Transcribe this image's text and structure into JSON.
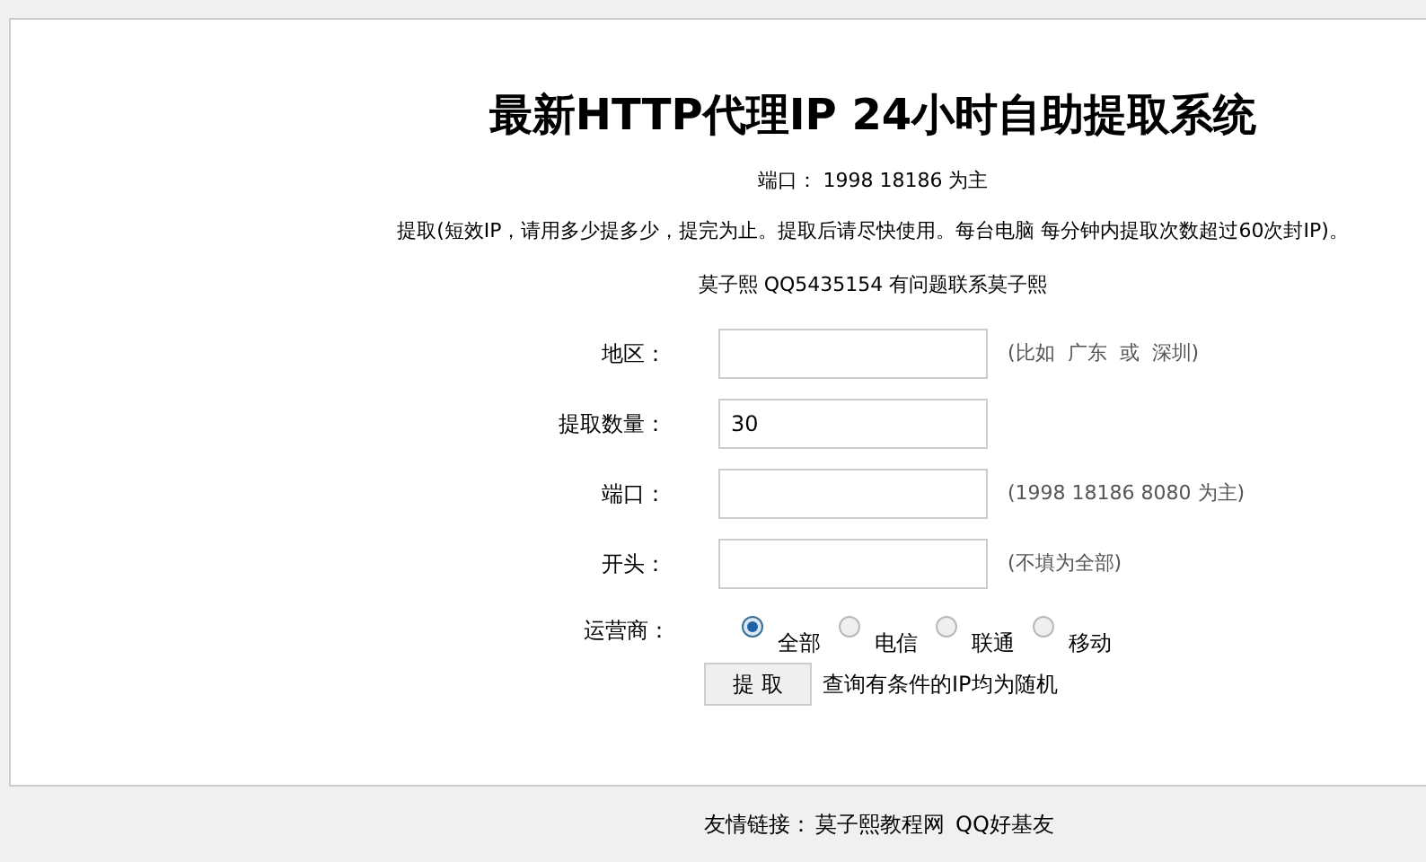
{
  "title": "最新HTTP代理IP 24小时自助提取系统",
  "port_note": "端口： 1998 18186 为主",
  "usage_note": "提取(短效IP，请用多少提多少，提完为止。提取后请尽快使用。每台电脑 每分钟内提取次数超过60次封IP)。",
  "contact_note": "莫子熙 QQ5435154 有问题联系莫子熙",
  "fields": [
    {
      "label": "地区：",
      "hint": "(比如  广东  或  深圳)"
    },
    {
      "label": "提取数量：",
      "value": "30"
    },
    {
      "label": "端口：",
      "hint": "(1998 18186 8080 为主)"
    },
    {
      "label": "开头：",
      "hint": "(不填为全部)"
    }
  ],
  "carrier": {
    "label": "运营商：",
    "options": [
      {
        "label": "全部",
        "selected": true
      },
      {
        "label": "电信",
        "selected": false
      },
      {
        "label": "联通",
        "selected": false
      },
      {
        "label": "移动",
        "selected": false
      }
    ]
  },
  "submit": {
    "label": "提 取",
    "note": "查询有条件的IP均为随机"
  },
  "footer": {
    "label": "友情链接：",
    "links": [
      "莫子熙教程网",
      "QQ好基友"
    ]
  }
}
